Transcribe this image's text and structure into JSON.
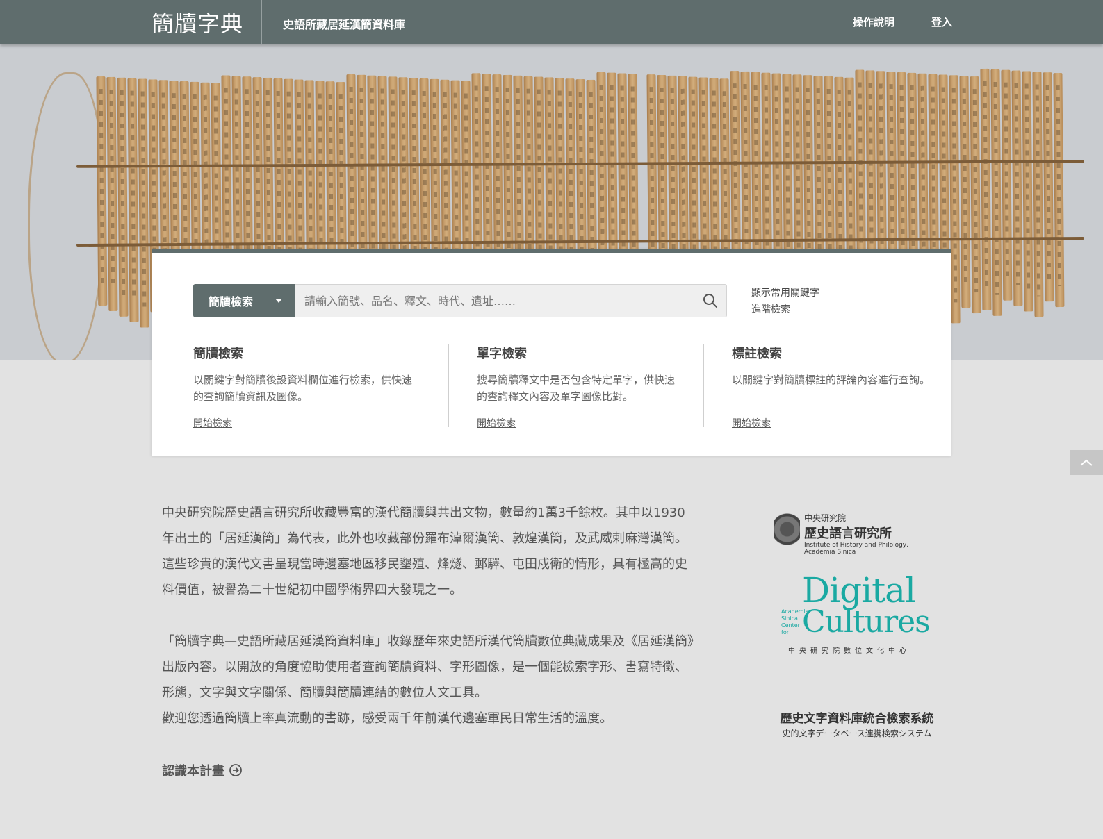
{
  "header": {
    "logo": "簡牘字典",
    "subtitle": "史語所藏居延漢簡資料庫",
    "nav": {
      "guide": "操作說明",
      "login": "登入"
    }
  },
  "search": {
    "type_label": "簡牘檢索",
    "placeholder": "請輸入簡號、品名、釋文、時代、遺址……",
    "show_keywords": "顯示常用關鍵字",
    "advanced": "進階檢索",
    "icon": "search-icon"
  },
  "search_modes": [
    {
      "title": "簡牘檢索",
      "desc": "以關鍵字對簡牘後設資料欄位進行檢索，供快速的查詢簡牘資訊及圖像。",
      "link": "開始檢索"
    },
    {
      "title": "單字檢索",
      "desc": "搜尋簡牘釋文中是否包含特定單字，供快速的查詢釋文內容及單字圖像比對。",
      "link": "開始檢索"
    },
    {
      "title": "標註檢索",
      "desc": "以關鍵字對簡牘標註的評論內容進行查詢。",
      "link": "開始檢索"
    }
  ],
  "intro": {
    "p1": "中央研究院歷史語言研究所收藏豐富的漢代簡牘與共出文物，數量約1萬3千餘枚。其中以1930年出土的「居延漢簡」為代表，此外也收藏部份羅布淖爾漢簡、敦煌漢簡，及武威剌麻灣漢簡。這些珍貴的漢代文書呈現當時邊塞地區移民墾殖、烽燧、郵驛、屯田戍衛的情形，具有極高的史料價值，被譽為二十世紀初中國學術界四大發現之一。",
    "p2": "「簡牘字典—史語所藏居延漢簡資料庫」收錄歷年來史語所漢代簡牘數位典藏成果及《居延漢簡》出版內容。以開放的角度協助使用者查詢簡牘資料、字形圖像，是一個能檢索字形、書寫特徵、形態，文字與文字關係、簡牘與簡牘連結的數位人文工具。",
    "p3": "歡迎您透過簡牘上率真流動的書跡，感受兩千年前漢代邊塞軍民日常生活的溫度。",
    "more": "認識本計畫"
  },
  "partners": {
    "ihp_top": "中央研究院",
    "ihp_name": "歷史語言研究所",
    "ihp_en": "Institute of History and Philology, Academia Sinica",
    "dc_line1": "Digital",
    "dc_line2": "Cultures",
    "dc_side": "Academia Sinica Center for",
    "dc_zh": "中央研究院數位文化中心",
    "hds_zh": "歷史文字資料庫統合檢索系統",
    "hds_ja": "史的文字データベース連携検索システム"
  },
  "colors": {
    "header": "#5f6d6d",
    "accent_teal": "#1aa9a2"
  }
}
